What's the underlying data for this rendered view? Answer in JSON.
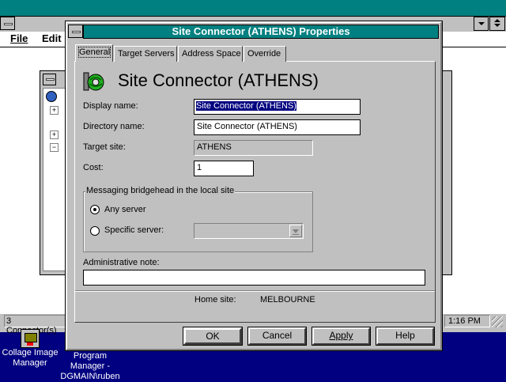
{
  "background_app": {
    "menu": {
      "file": "File",
      "edit": "Edit"
    },
    "status": {
      "connectors": "3 Connector(s)",
      "time": "1:16 PM"
    }
  },
  "desktop_icons": [
    {
      "label_line1": "Collage Image",
      "label_line2": "Manager",
      "icon": "collage-icon"
    },
    {
      "label_line1": "Program",
      "label_line2": "Manager -",
      "label_line3": "DGMAIN\\ruben",
      "icon": "program-manager-icon"
    }
  ],
  "dialog": {
    "title": "Site Connector (ATHENS) Properties",
    "tabs": [
      "General",
      "Target Servers",
      "Address Space",
      "Override"
    ],
    "active_tab": "General",
    "heading": "Site Connector (ATHENS)",
    "fields": {
      "display_name_label": "Display name:",
      "display_name_value": "Site Connector (ATHENS)",
      "directory_name_label": "Directory name:",
      "directory_name_value": "Site Connector (ATHENS)",
      "target_site_label": "Target site:",
      "target_site_value": "ATHENS",
      "cost_label": "Cost:",
      "cost_value": "1"
    },
    "bridgehead": {
      "group_label": "Messaging bridgehead in the local site",
      "any_server": "Any server",
      "specific_server": "Specific server:",
      "selected": "any_server"
    },
    "admin_note_label": "Administrative note:",
    "admin_note_value": "",
    "home_site_label": "Home site:",
    "home_site_value": "MELBOURNE",
    "buttons": {
      "ok": "OK",
      "cancel": "Cancel",
      "apply": "Apply",
      "help": "Help"
    },
    "colors": {
      "title_bar": "#008080",
      "selection": "#000080"
    }
  }
}
